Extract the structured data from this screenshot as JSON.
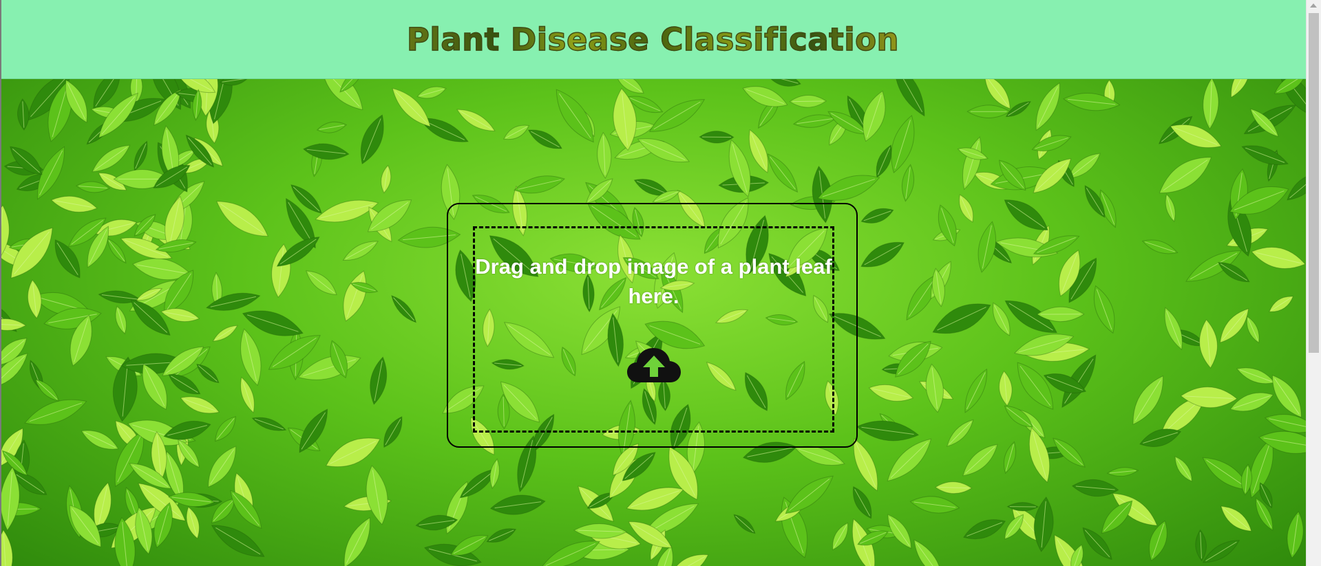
{
  "header": {
    "title": "Plant Disease Classification",
    "background_color": "#87f0b0"
  },
  "upload": {
    "prompt": "Drag and drop image of a plant leaf here.",
    "icon": "cloud-upload-icon"
  },
  "background": {
    "theme": "green-leaves",
    "colors": [
      "#2f8a0c",
      "#5cc21a",
      "#8be035",
      "#b8ee4a"
    ]
  },
  "scrollbar": {
    "visible": true
  }
}
